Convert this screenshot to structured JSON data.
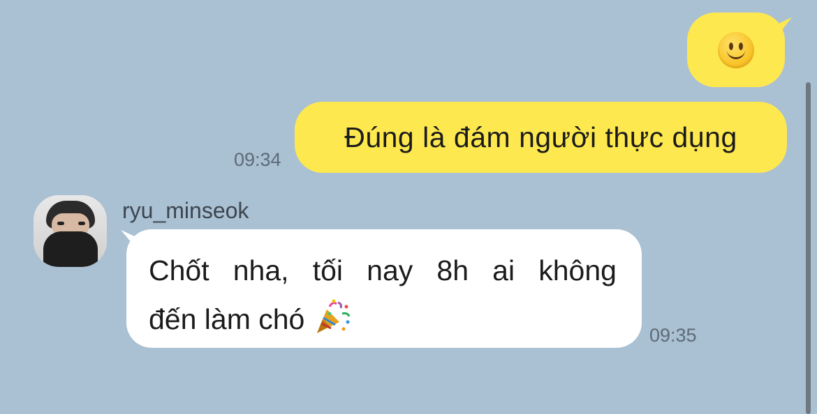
{
  "messages": {
    "outgoing_emoji": {
      "emoji": "slightly-smiling-face-icon"
    },
    "outgoing_text": {
      "text": "Đúng là đám người thực dụng",
      "time": "09:34"
    },
    "incoming": {
      "sender": "ryu_minseok",
      "words_line1": [
        "Chốt",
        "nha,",
        "tối",
        "nay",
        "8h",
        "ai",
        "không"
      ],
      "line2": "đến làm chó",
      "emoji": "party-popper-icon",
      "time": "09:35"
    }
  },
  "colors": {
    "background": "#aac0d3",
    "outgoing_bubble": "#fee84f",
    "incoming_bubble": "#ffffff"
  }
}
